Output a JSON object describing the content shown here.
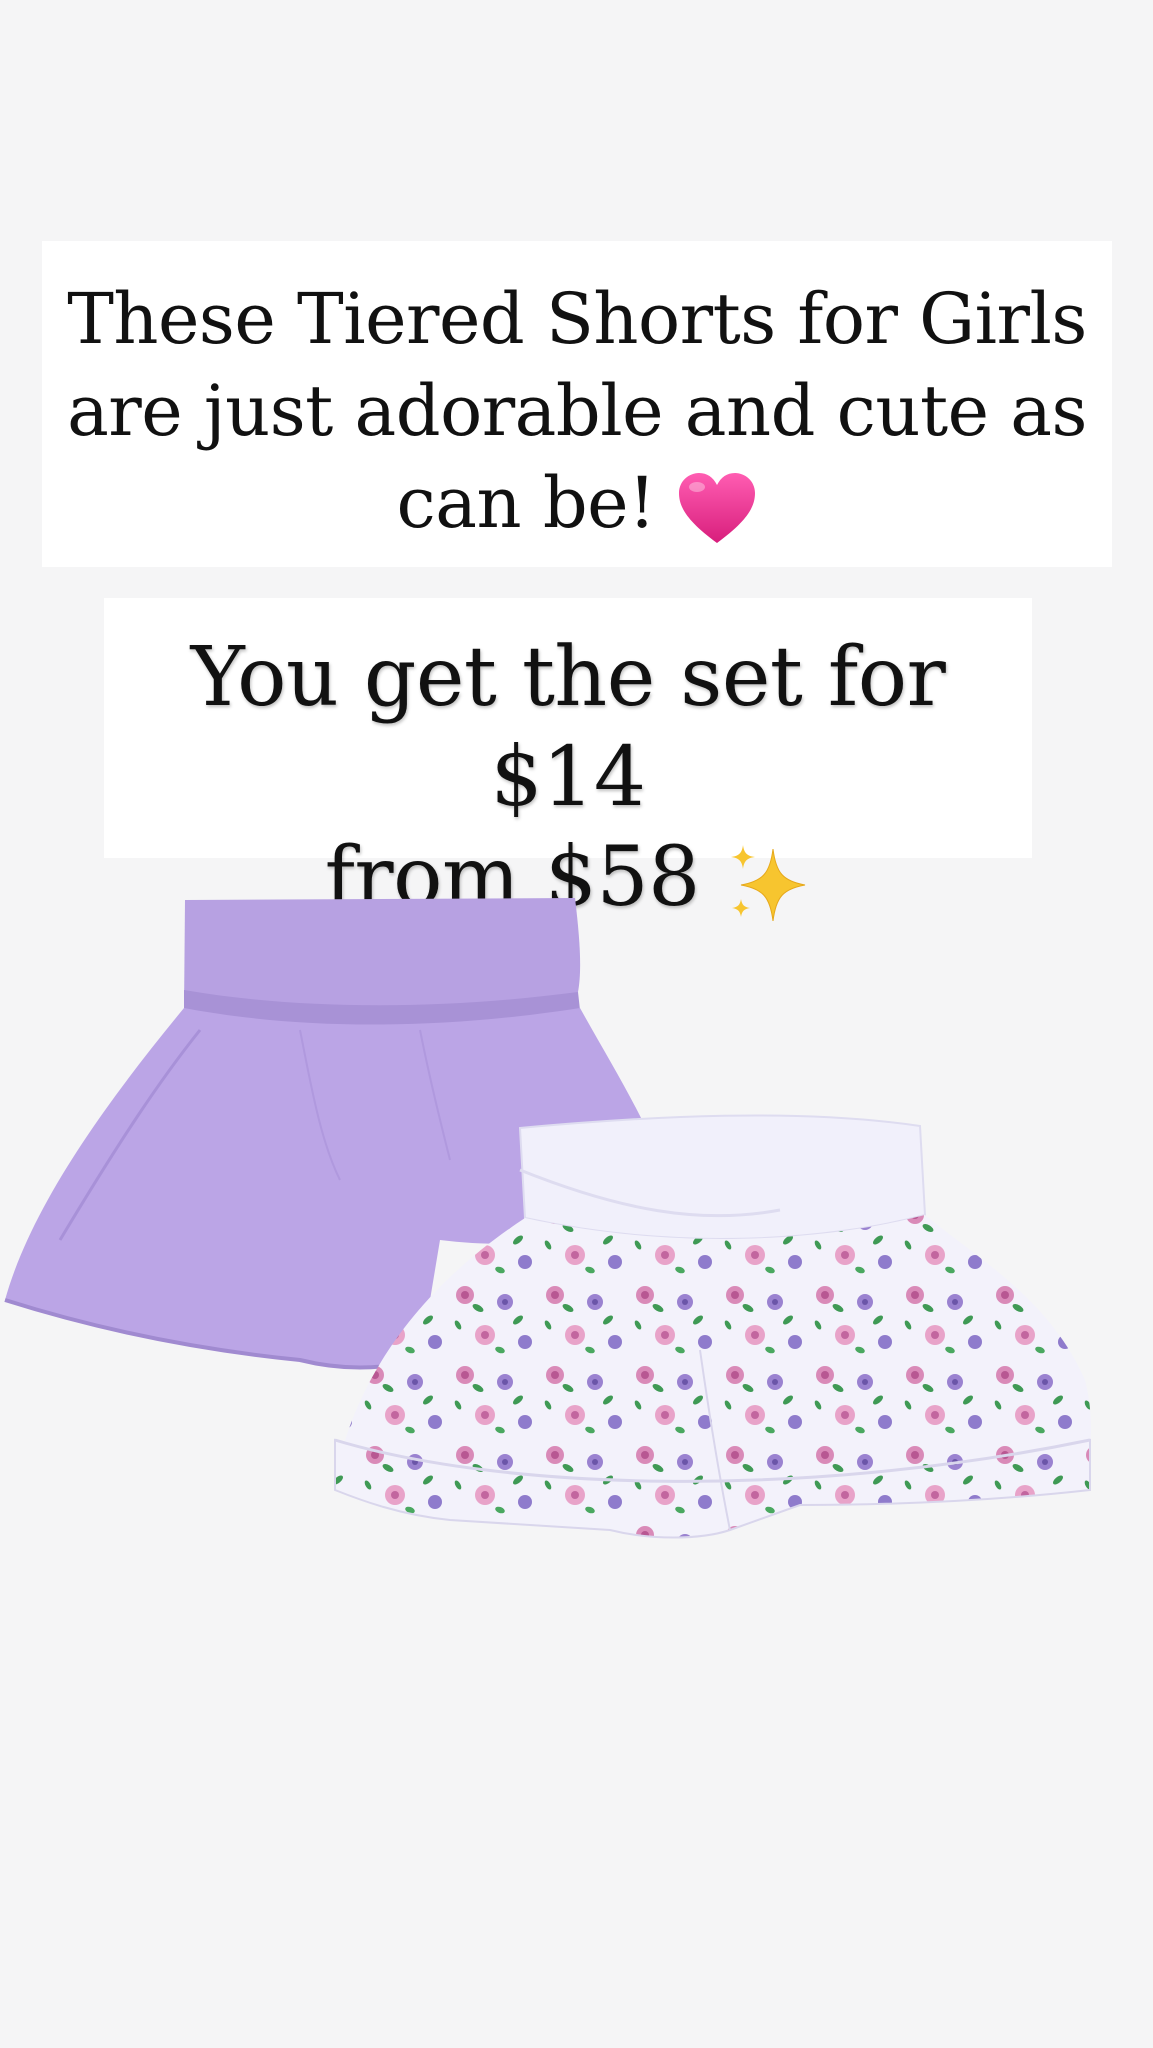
{
  "caption_1": {
    "line_1": "These Tiered Shorts for Girls",
    "line_2": "are just adorable and cute as",
    "line_3": "can be!",
    "emoji": "pink-heart-icon"
  },
  "caption_2": {
    "line_1": "You get the set for $14",
    "line_2": "from $58",
    "emoji": "sparkles-icon"
  },
  "product": {
    "items": [
      {
        "name": "lavender-shorts",
        "color": "#b9a3e3"
      },
      {
        "name": "floral-tiered-shorts",
        "color": "#f2f2fb"
      }
    ]
  },
  "colors": {
    "background": "#f5f5f6",
    "caption_background": "#ffffff",
    "text": "#111111",
    "heart": "#ee3f93",
    "sparkles": "#f7c52f"
  }
}
